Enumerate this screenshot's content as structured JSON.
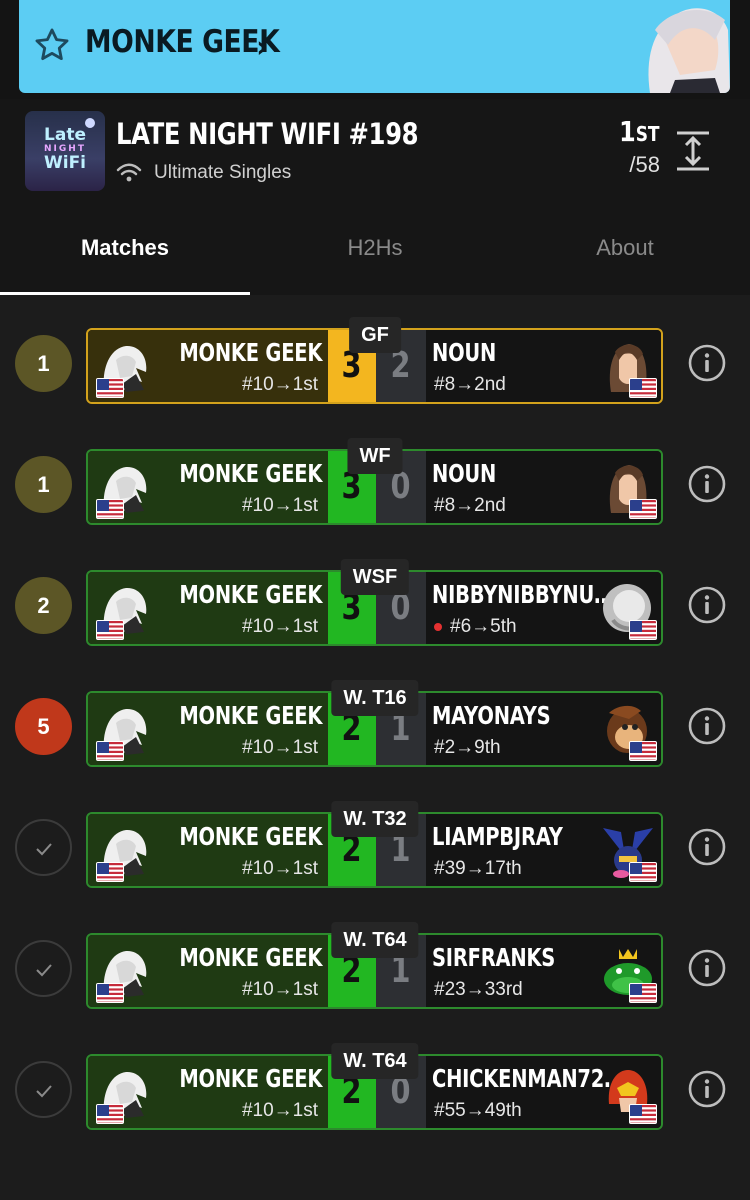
{
  "banner": {
    "player_name": "MONKE GEEK",
    "chevron": "›",
    "star_icon": "star-outline-icon"
  },
  "event": {
    "logo_line1": "Late",
    "logo_line2": "NIGHT",
    "logo_line3": "WiFi",
    "title": "LATE NIGHT WIFI #198",
    "subtitle": "Ultimate Singles",
    "placement_number": "1",
    "placement_suffix": "ST",
    "entrants": "/58"
  },
  "tabs": [
    {
      "label": "Matches",
      "active": true
    },
    {
      "label": "H2Hs",
      "active": false
    },
    {
      "label": "About",
      "active": false
    }
  ],
  "matches": [
    {
      "round": "GF",
      "games": "1",
      "status": "olive",
      "gold": true,
      "p1": {
        "name": "MONKE GEEK",
        "seed": "#10→1st",
        "score": "3"
      },
      "p2": {
        "name": "NOUN",
        "seed": "#8→2nd",
        "score": "2",
        "dq": false,
        "character": "brown-hair-character"
      }
    },
    {
      "round": "WF",
      "games": "1",
      "status": "olive",
      "gold": false,
      "p1": {
        "name": "MONKE GEEK",
        "seed": "#10→1st",
        "score": "3"
      },
      "p2": {
        "name": "NOUN",
        "seed": "#8→2nd",
        "score": "0",
        "dq": false,
        "character": "brown-hair-character"
      }
    },
    {
      "round": "WSF",
      "games": "2",
      "status": "olive",
      "gold": false,
      "p1": {
        "name": "MONKE GEEK",
        "seed": "#10→1st",
        "score": "3"
      },
      "p2": {
        "name": "NIBBYNIBBYNU…",
        "seed": "#6→5th",
        "score": "0",
        "dq": true,
        "character": "silver-character"
      }
    },
    {
      "round": "W. T16",
      "games": "5",
      "status": "red",
      "gold": false,
      "p1": {
        "name": "MONKE GEEK",
        "seed": "#10→1st",
        "score": "2"
      },
      "p2": {
        "name": "MAYONAYS",
        "seed": "#2→9th",
        "score": "1",
        "dq": false,
        "character": "donkey-kong-character"
      }
    },
    {
      "round": "W. T32",
      "games": "",
      "status": "done",
      "gold": false,
      "p1": {
        "name": "MONKE GEEK",
        "seed": "#10→1st",
        "score": "2"
      },
      "p2": {
        "name": "LIAMPBJRAY",
        "seed": "#39→17th",
        "score": "1",
        "dq": false,
        "character": "meta-knight-character"
      }
    },
    {
      "round": "W. T64",
      "games": "",
      "status": "done",
      "gold": false,
      "p1": {
        "name": "MONKE GEEK",
        "seed": "#10→1st",
        "score": "2"
      },
      "p2": {
        "name": "SIRFRANKS",
        "seed": "#23→33rd",
        "score": "1",
        "dq": false,
        "character": "king-k-rool-character"
      }
    },
    {
      "round": "W. T64",
      "games": "",
      "status": "done",
      "gold": false,
      "p1": {
        "name": "MONKE GEEK",
        "seed": "#10→1st",
        "score": "2"
      },
      "p2": {
        "name": "CHICKENMAN72…",
        "seed": "#55→49th",
        "score": "0",
        "dq": false,
        "character": "captain-falcon-character"
      }
    }
  ],
  "colors": {
    "banner": "#5ccdf3",
    "win_green": "#22b722",
    "gold": "#f3b61f",
    "olive": "#5c5626",
    "red": "#c0381b"
  }
}
